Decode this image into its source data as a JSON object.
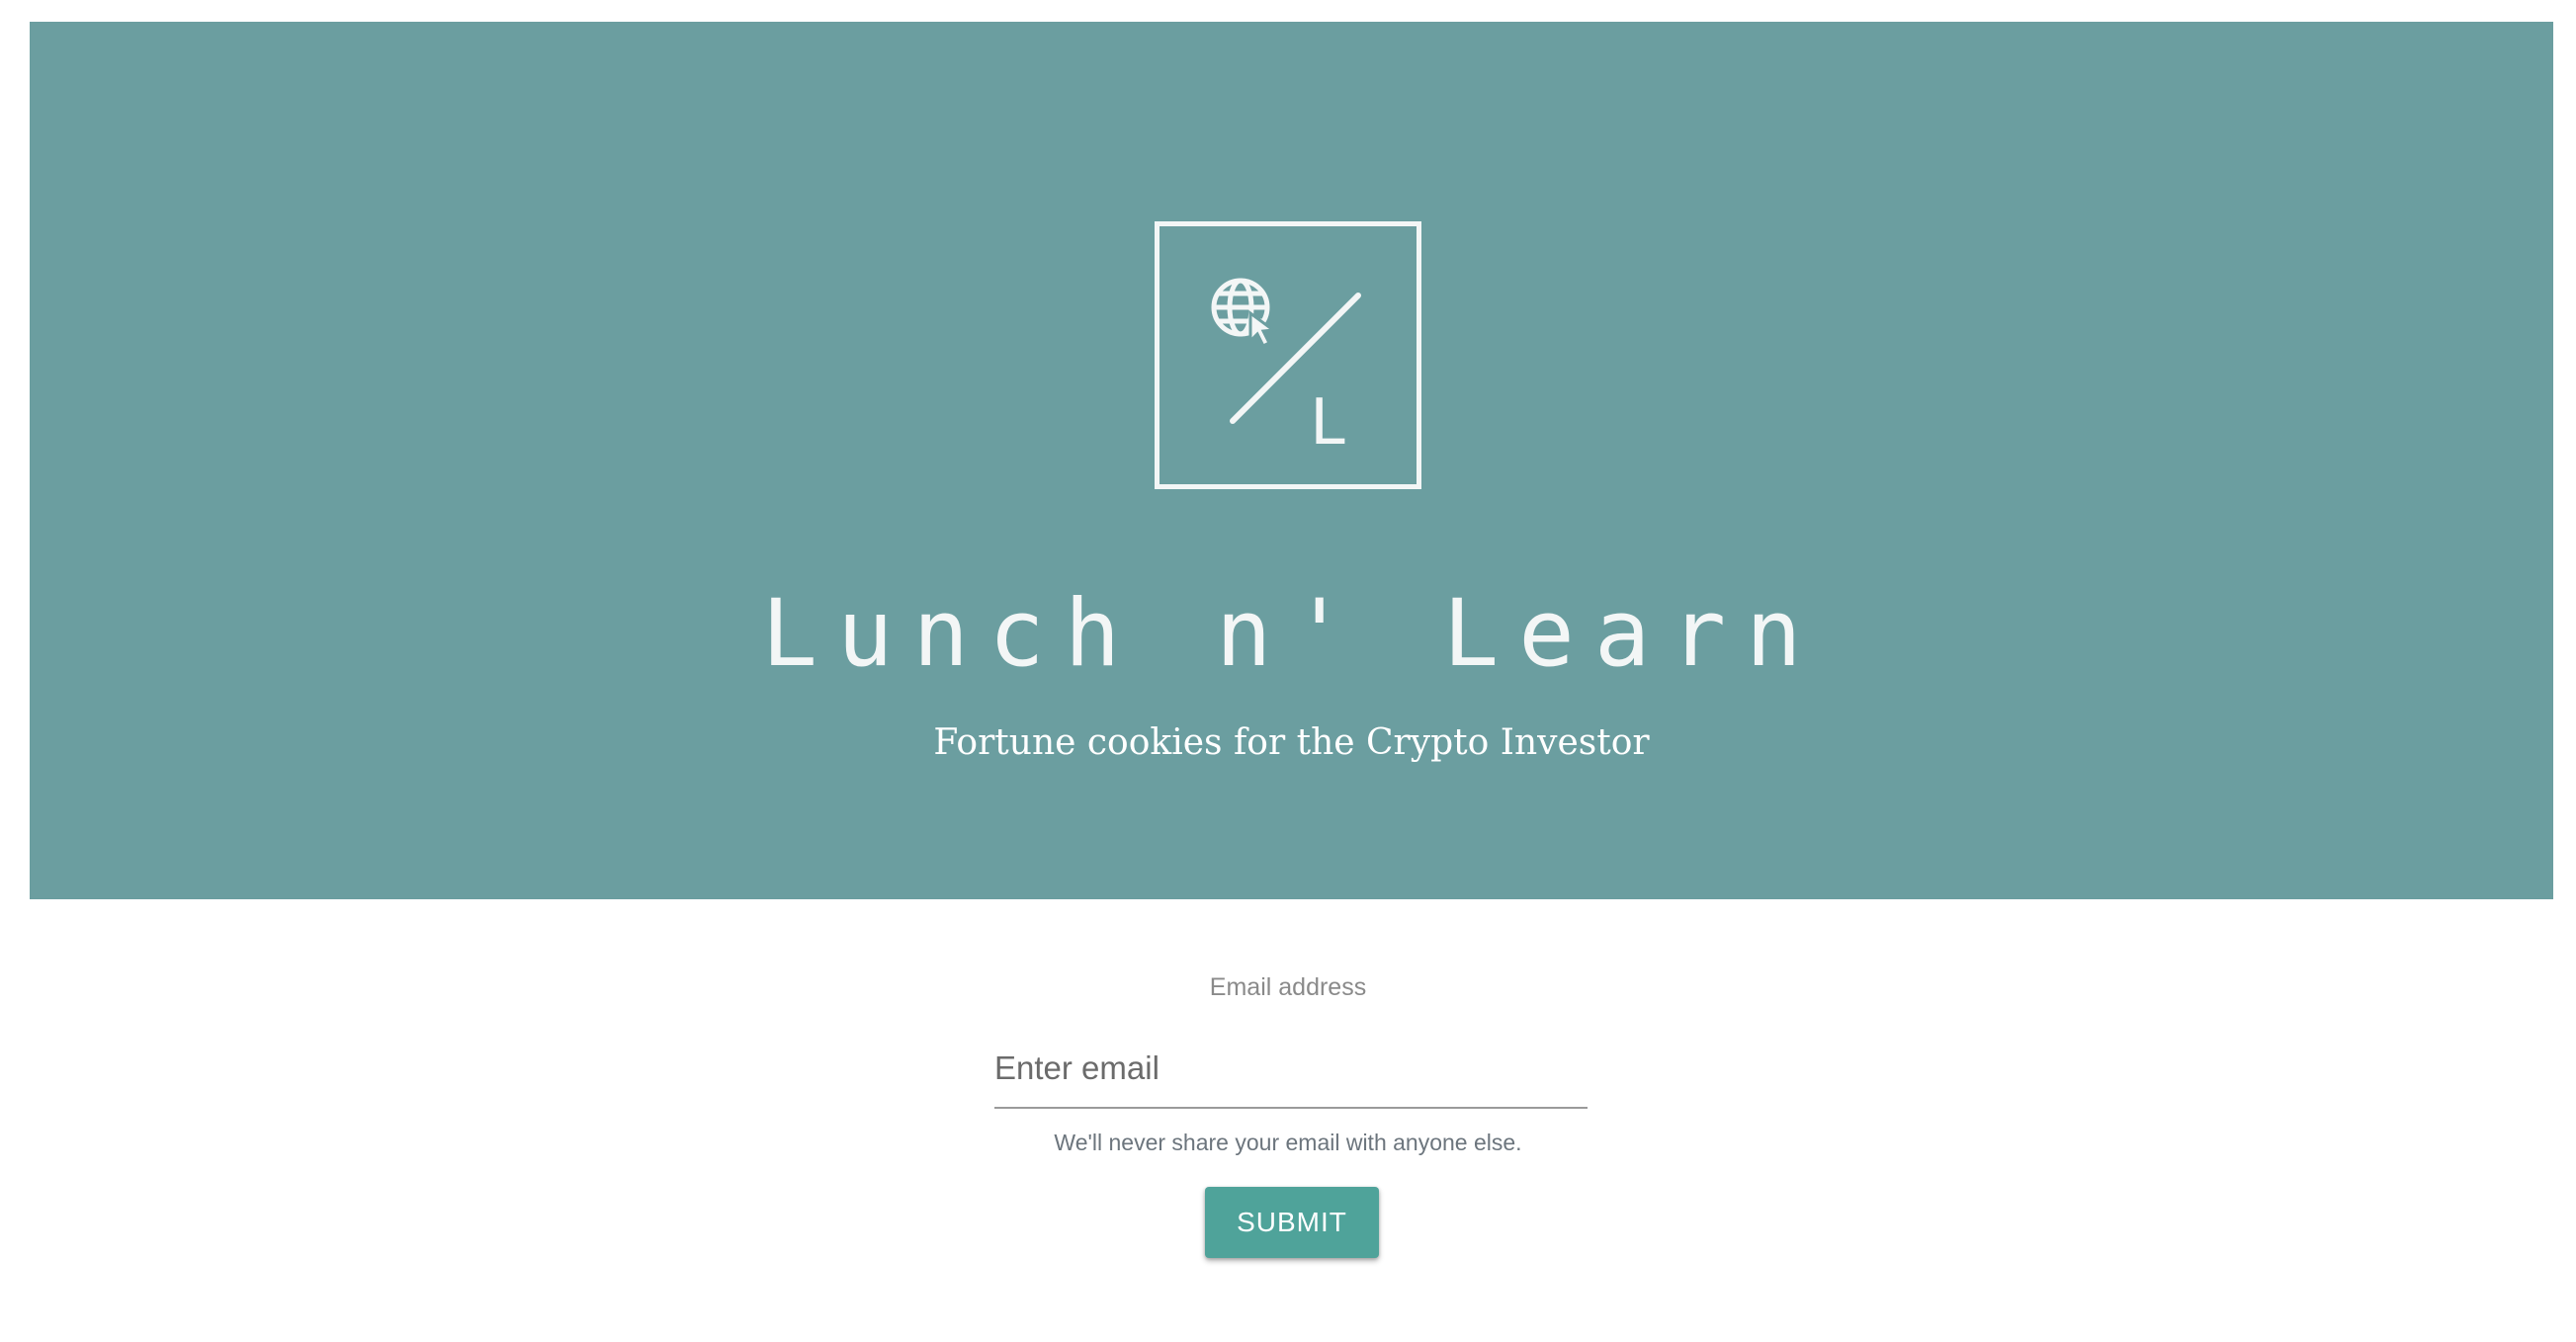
{
  "hero": {
    "background_color": "#6b9ea0",
    "logo": {
      "icon": "globe-cursor-icon",
      "letter": "L"
    },
    "title": "Lunch n' Learn",
    "subtitle": "Fortune cookies for the Crypto Investor"
  },
  "form": {
    "email_label": "Email address",
    "email_placeholder": "Enter email",
    "email_value": "",
    "help_text": "We'll never share your email with anyone else.",
    "submit_label": "SUBMIT",
    "button_color": "#4fa39a"
  }
}
